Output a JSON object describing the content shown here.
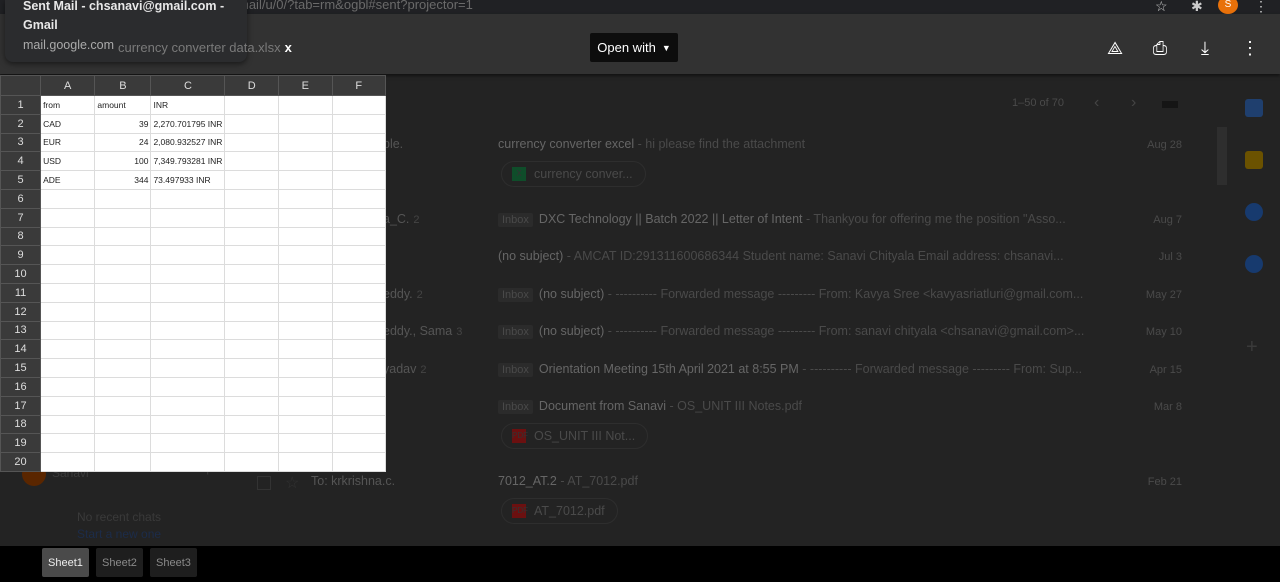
{
  "browser": {
    "url": "mail/u/0/?tab=rm&ogbl#sent?projector=1",
    "profile_initial": "S"
  },
  "tooltip": {
    "title": "Sent Mail - chsanavi@gmail.com - Gmail",
    "host": "mail.google.com"
  },
  "viewer": {
    "filename": "currency converter data.xlsx",
    "open_with": "Open with",
    "close": "x"
  },
  "spreadsheet": {
    "columns": [
      "A",
      "B",
      "C",
      "D",
      "E",
      "F"
    ],
    "row_count": 20,
    "rows": [
      [
        "from",
        "amount",
        "INR"
      ],
      [
        "CAD",
        "39",
        "2,270.701795 INR"
      ],
      [
        "EUR",
        "24",
        "2,080.932527 INR"
      ],
      [
        "USD",
        "100",
        "7,349.793281 INR"
      ],
      [
        "ADE",
        "344",
        "73.497933 INR"
      ]
    ],
    "sheets": [
      "Sheet1",
      "Sheet2",
      "Sheet3"
    ],
    "active_sheet": "Sheet1"
  },
  "gmail": {
    "pagination": "1–50 of 70",
    "emails": [
      {
        "sender": "ple.",
        "badge": "",
        "subject": "currency converter excel",
        "snippet": " - hi please find the attachment",
        "date": "Aug 28",
        "attachment": "currency conver...",
        "att_type": "xls"
      },
      {
        "sender": "a_C.",
        "count": "2",
        "badge": "Inbox",
        "subject": "DXC Technology || Batch 2022 || Letter of Intent",
        "snippet": " - Thankyou for offering me the position \"Asso...",
        "date": "Aug 7"
      },
      {
        "sender": "",
        "badge": "",
        "subject": "(no subject)",
        "snippet": " - AMCAT ID:291311600686344 Student name: Sanavi Chityala Email address: chsanavi...",
        "date": "Jul 3"
      },
      {
        "sender": "eddy.",
        "count": "2",
        "badge": "Inbox",
        "subject": "(no subject)",
        "snippet": " - ---------- Forwarded message --------- From: Kavya Sree <kavyasriatluri@gmail.com...",
        "date": "May 27"
      },
      {
        "sender": "eddy., Sama",
        "count": "3",
        "badge": "Inbox",
        "subject": "(no subject)",
        "snippet": " - ---------- Forwarded message --------- From: sanavi chityala <chsanavi@gmail.com>...",
        "date": "May 10"
      },
      {
        "sender": "yadav",
        "count": "2",
        "badge": "Inbox",
        "subject": "Orientation Meeting 15th April 2021 at 8:55 PM",
        "snippet": " - ---------- Forwarded message --------- From: Sup...",
        "date": "Apr 15"
      },
      {
        "sender": "",
        "badge": "Inbox",
        "subject": "Document from Sanavi",
        "snippet": " - OS_UNIT III Notes.pdf",
        "date": "Mar 8",
        "attachment": "OS_UNIT III Not...",
        "att_type": "pdf"
      },
      {
        "sender": "To: krkrishna.c.",
        "badge": "",
        "subject": "7012_AT.2",
        "snippet": " - AT_7012.pdf",
        "date": "Feb 21",
        "attachment": "AT_7012.pdf",
        "att_type": "pdf"
      }
    ],
    "chat": {
      "user": "Sanavi",
      "no_chats": "No recent chats",
      "start_new": "Start a new one"
    }
  },
  "colors": {
    "accent_excel": "#0f4d2a",
    "pdf": "#6b1010",
    "profile": "#e8710a"
  }
}
